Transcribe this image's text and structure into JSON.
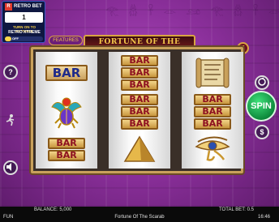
{
  "promo": {
    "logo_text": "RETRO BET",
    "counter": "1",
    "line1": "TURN ON TO ACTIVATE",
    "line2": "RETRO XTREME",
    "toggle_label": "OFF"
  },
  "game": {
    "features_label": "FEATURES",
    "title": "FORTUNE OF THE SCARAB",
    "lines_count": "5"
  },
  "reels": [
    [
      "BAR",
      "scarab",
      "BAR BAR"
    ],
    [
      "BAR BAR BAR",
      "BAR BAR BAR",
      "pyramid"
    ],
    [
      "scroll",
      "BAR BAR BAR",
      "eye-of-horus"
    ]
  ],
  "buttons": {
    "spin_label": "SPIN",
    "help_label": "?",
    "coin_label": "$"
  },
  "status": {
    "balance_label": "BALANCE:",
    "balance": "5,000",
    "total_bet_label": "TOTAL BET:",
    "total_bet": "0.5",
    "mode": "FUN",
    "game_name": "Fortune Of The Scarab",
    "time": "16:46"
  },
  "colors": {
    "background": "#8a2f9a",
    "spin": "#1fb357",
    "gold": "#d9a441"
  }
}
